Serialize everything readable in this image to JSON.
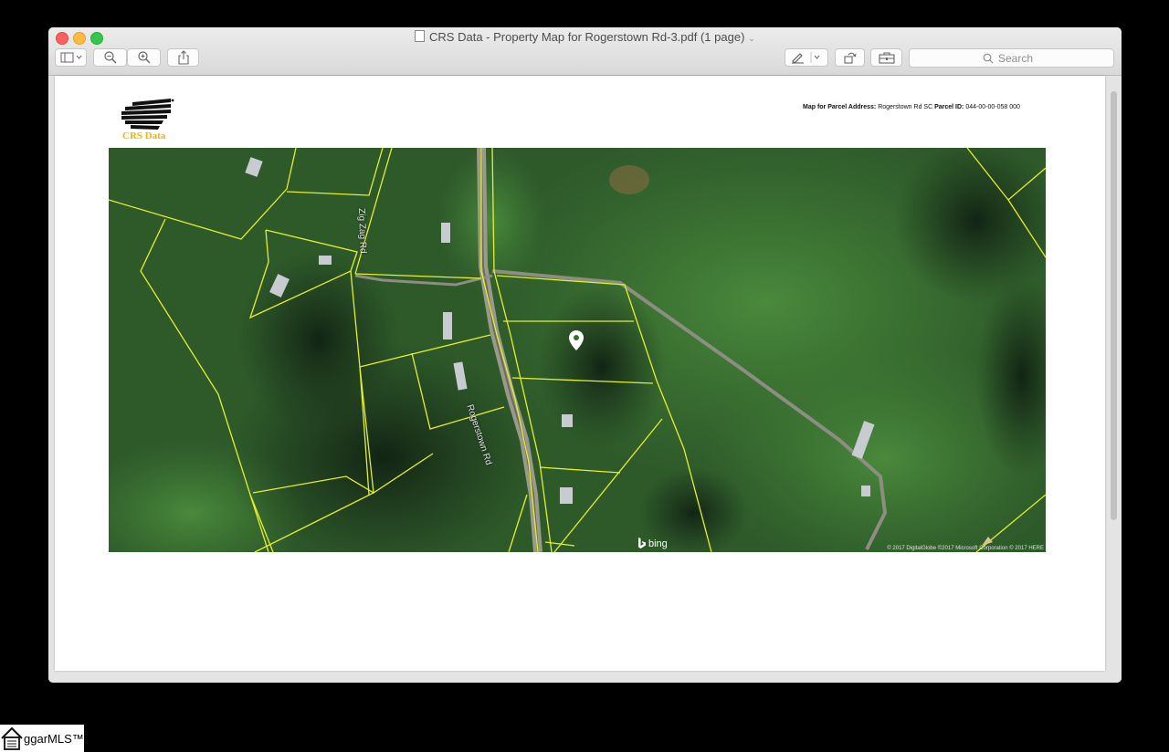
{
  "window": {
    "title": "CRS Data - Property Map for Rogerstown Rd-3.pdf (1 page)",
    "title_chevron": "⌄"
  },
  "toolbar": {
    "search_placeholder": "Search"
  },
  "document": {
    "logo_text": "CRS Data",
    "parcel_address_label": "Map for Parcel Address:",
    "parcel_address_value": "Rogerstown Rd SC",
    "parcel_id_label": "Parcel ID:",
    "parcel_id_value": "044-00-00-058 000"
  },
  "map": {
    "road_labels": [
      "Rogerstown Rd",
      "Zig Zag Rd"
    ],
    "provider": "bing",
    "attribution": "© 2017 DigitalGlobe ©2017 Microsoft Corporation © 2017 HERE",
    "colors": {
      "parcel_lines": "#e6ef2c",
      "pin": "#ffffff"
    }
  },
  "watermark": {
    "text": "ggarMLS™"
  }
}
